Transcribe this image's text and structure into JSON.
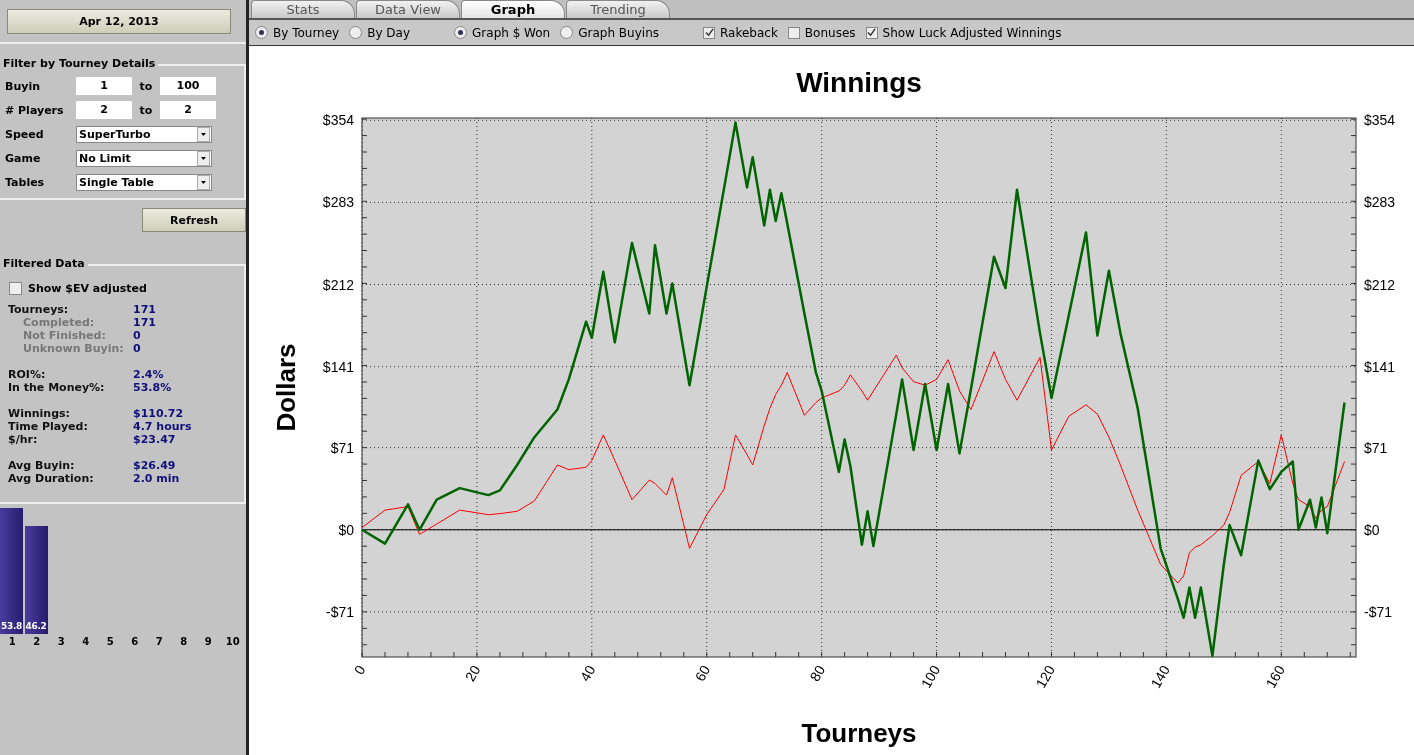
{
  "date_button": "Apr 12, 2013",
  "filter": {
    "title": "Filter by Tourney Details",
    "ranges": [
      {
        "label": "Buyin",
        "from": "1",
        "to_label": "to",
        "to": "100"
      },
      {
        "label": "# Players",
        "from": "2",
        "to_label": "to",
        "to": "2"
      }
    ],
    "selects": [
      {
        "label": "Speed",
        "value": "SuperTurbo"
      },
      {
        "label": "Game",
        "value": "No Limit"
      },
      {
        "label": "Tables",
        "value": "Single Table"
      }
    ]
  },
  "refresh_button": "Refresh",
  "filtered": {
    "title": "Filtered Data",
    "ev_checkbox": {
      "label": "Show $EV adjusted",
      "checked": false
    },
    "groups": [
      [
        {
          "label": "Tourneys:",
          "value": "171",
          "sub": false
        },
        {
          "label": "Completed:",
          "value": "171",
          "sub": true
        },
        {
          "label": "Not Finished:",
          "value": "0",
          "sub": true
        },
        {
          "label": "Unknown Buyin:",
          "value": "0",
          "sub": true
        }
      ],
      [
        {
          "label": "ROI%:",
          "value": "2.4%",
          "sub": false
        },
        {
          "label": "In the Money%:",
          "value": "53.8%",
          "sub": false
        }
      ],
      [
        {
          "label": "Winnings:",
          "value": "$110.72",
          "sub": false
        },
        {
          "label": "Time Played:",
          "value": "4.7 hours",
          "sub": false
        },
        {
          "label": "$/hr:",
          "value": "$23.47",
          "sub": false
        }
      ],
      [
        {
          "label": "Avg Buyin:",
          "value": "$26.49",
          "sub": false
        },
        {
          "label": "Avg Duration:",
          "value": "2.0 min",
          "sub": false
        }
      ]
    ],
    "chart_data": {
      "type": "bar",
      "categories": [
        "1",
        "2",
        "3",
        "4",
        "5",
        "6",
        "7",
        "8",
        "9",
        "10"
      ],
      "values": [
        53.8,
        46.2,
        null,
        null,
        null,
        null,
        null,
        null,
        null,
        null
      ],
      "data_labels": true
    }
  },
  "tabs": [
    {
      "label": "Stats",
      "selected": false
    },
    {
      "label": "Data View",
      "selected": false
    },
    {
      "label": "Graph",
      "selected": true
    },
    {
      "label": "Trending",
      "selected": false
    }
  ],
  "options": [
    [
      {
        "kind": "radio",
        "label": "By Tourney",
        "selected": true
      },
      {
        "kind": "radio",
        "label": "By Day",
        "selected": false
      }
    ],
    [
      {
        "kind": "radio",
        "label": "Graph $ Won",
        "selected": true
      },
      {
        "kind": "radio",
        "label": "Graph Buyins",
        "selected": false
      }
    ],
    [
      {
        "kind": "checkbox",
        "label": "Rakeback",
        "checked": true
      },
      {
        "kind": "checkbox",
        "label": "Bonuses",
        "checked": false
      },
      {
        "kind": "checkbox",
        "label": "Show Luck Adjusted Winnings",
        "checked": true
      }
    ]
  ],
  "graph": {
    "right_axis_labels": [
      "$354",
      "$283",
      "$212",
      "$141",
      "$71",
      "$0",
      "-$71"
    ],
    "chart_data": {
      "type": "line",
      "title": "Winnings",
      "xlabel": "Tourneys",
      "ylabel": "Dollars",
      "x": [
        0,
        4,
        8,
        10,
        13,
        17,
        22,
        24,
        27,
        30,
        34,
        36,
        39,
        40,
        42,
        44,
        47,
        50,
        51,
        53,
        54,
        57,
        60,
        63,
        65,
        67,
        68,
        70,
        71,
        72,
        73,
        74,
        77,
        79,
        80,
        83,
        84,
        85,
        87,
        88,
        89,
        93,
        94,
        96,
        98,
        100,
        102,
        104,
        106,
        110,
        112,
        114,
        118,
        120,
        123,
        126,
        128,
        130,
        132,
        135,
        139,
        142,
        143,
        144,
        145,
        146,
        148,
        150,
        151,
        153,
        156,
        158,
        160,
        162,
        163,
        165,
        166,
        167,
        168,
        171
      ],
      "series": [
        {
          "color": "#006400",
          "values": [
            0,
            -12,
            22,
            0,
            26,
            36,
            30,
            34,
            56,
            80,
            104,
            130,
            180,
            166,
            223,
            162,
            248,
            187,
            246,
            187,
            213,
            125,
            210,
            295,
            352,
            296,
            322,
            263,
            294,
            267,
            291,
            265,
            187,
            136,
            120,
            50,
            78,
            55,
            -13,
            16,
            -14,
            100,
            130,
            69,
            126,
            69,
            126,
            66,
            122,
            236,
            209,
            294,
            170,
            114,
            185,
            257,
            168,
            224,
            170,
            105,
            -16,
            -60,
            -76,
            -50,
            -76,
            -50,
            -109,
            -30,
            4,
            -22,
            60,
            35,
            50,
            59,
            0,
            26,
            2,
            28,
            -3,
            110
          ]
        },
        {
          "color": "#ff0000",
          "values": [
            2,
            17,
            20,
            -4,
            5,
            17,
            13,
            14,
            16,
            25,
            56,
            52,
            54,
            60,
            82,
            60,
            26,
            43,
            40,
            30,
            45,
            -16,
            13,
            35,
            82,
            65,
            56,
            90,
            105,
            117,
            125,
            136,
            99,
            110,
            114,
            120,
            125,
            134,
            120,
            112,
            120,
            151,
            140,
            128,
            125,
            130,
            147,
            120,
            104,
            154,
            130,
            112,
            149,
            69,
            98,
            108,
            100,
            80,
            56,
            17,
            -30,
            -46,
            -40,
            -20,
            -15,
            -13,
            -5,
            4,
            15,
            47,
            59,
            40,
            82,
            40,
            26,
            20,
            10,
            17,
            20,
            59
          ]
        }
      ],
      "xlim": [
        0,
        173
      ],
      "ylim": [
        -110,
        356
      ],
      "grid": true,
      "xticks": [
        0,
        20,
        40,
        60,
        80,
        100,
        120,
        140,
        160
      ],
      "yticks": [
        {
          "value": -71,
          "label": "-$71"
        },
        {
          "value": 0,
          "label": "$0"
        },
        {
          "value": 71,
          "label": "$71"
        },
        {
          "value": 141,
          "label": "$141"
        },
        {
          "value": 212,
          "label": "$212"
        },
        {
          "value": 283,
          "label": "$283"
        },
        {
          "value": 354,
          "label": "$354"
        }
      ]
    }
  }
}
